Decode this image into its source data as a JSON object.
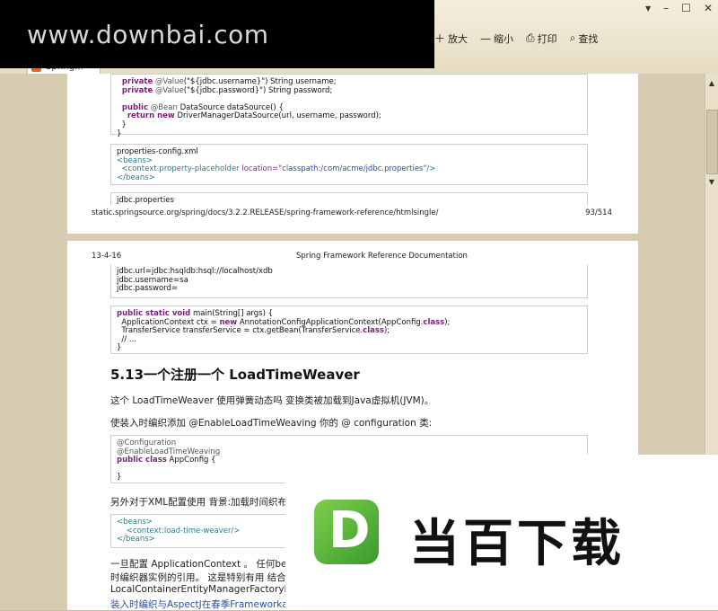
{
  "window": {
    "controls": [
      "▾",
      "–",
      "☐",
      "✕"
    ]
  },
  "watermark": {
    "text": "www.downbai.com"
  },
  "toolbar": {
    "zoom_in_label": "放大",
    "zoom_out_label": "缩小",
    "print_label": "打印",
    "find_label": "查找"
  },
  "tab": {
    "label": "Spring..."
  },
  "page1": {
    "code1": [
      "  private @Value(\"${jdbc.username}\") String username;",
      "  private @Value(\"${jdbc.password}\") String password;",
      "",
      "  public @Bean DataSource dataSource() {",
      "    return new DriverManagerDataSource(url, username, password);",
      "  }",
      "}"
    ],
    "code2_title": "properties-config.xml",
    "code2_line1": "<beans>",
    "code2_line2_tag": "<context:property-placeholder",
    "code2_line2_attr": "location=",
    "code2_line2_val": "\"classpath:/com/acme/jdbc.properties\"",
    "code2_line2_end": "/>",
    "code2_line3": "</beans>",
    "code3_title": "jdbc.properties",
    "footer_url": "static.springsource.org/spring/docs/3.2.2.RELEASE/spring-framework-reference/htmlsingle/",
    "footer_page": "93/514"
  },
  "page2": {
    "header_date": "13-4-16",
    "header_title": "Spring Framework Reference Documentation",
    "props": [
      "jdbc.url=jdbc:hsqldb:hsql://localhost/xdb",
      "jdbc.username=sa",
      "jdbc.password="
    ],
    "main_l1_kw": "public static void",
    "main_l1_rest": " main(String[] args) {",
    "main_l2_a": "  ApplicationContext ctx = ",
    "main_l2_kw": "new",
    "main_l2_b": " AnnotationConfigApplicationContext(AppConfig.",
    "main_l2_kw2": "class",
    "main_l2_c": ");",
    "main_l3_a": "  TransferService transferService = ctx.getBean(TransferService.",
    "main_l3_kw": "class",
    "main_l3_b": ");",
    "main_l4": "  // ...",
    "main_l5": "}",
    "heading": "5.13一个注册一个 LoadTimeWeaver",
    "para1": "这个 LoadTimeWeaver 使用弹簧动态吗 变换类被加载到Java虚拟机(JVM)。",
    "para2": "使装入时编织添加 @EnableLoadTimeWeaving 你的 @ configuration 类:",
    "cfg_l1": "@Configuration",
    "cfg_l2": "@EnableLoadTimeWeaving",
    "cfg_l3_kw": "public class",
    "cfg_l3_rest": " AppConfig {",
    "cfg_l4": "",
    "cfg_l5": "}",
    "para3": "另外对于XML配置使用 背景:加载时间织布 元",
    "xml_l1": "<beans>",
    "xml_l2": "    <context:load-time-weaver/>",
    "xml_l3": "</beans>",
    "para4_a": "一旦配置 ApplicationContext 。 任何bean户",
    "para4_b": "时编织器实例的引用。 这是特别有用 结合 ",
    "para4_b_link": "Sp",
    "para4_c": "LocalContainerEntityManagerFactoryBean",
    "para4_d_link": "装入时编织与AspectJ在春季Frameworka",
    "para4_d_end": " 。"
  },
  "logo": {
    "letter": "D",
    "name": "当百下载"
  }
}
